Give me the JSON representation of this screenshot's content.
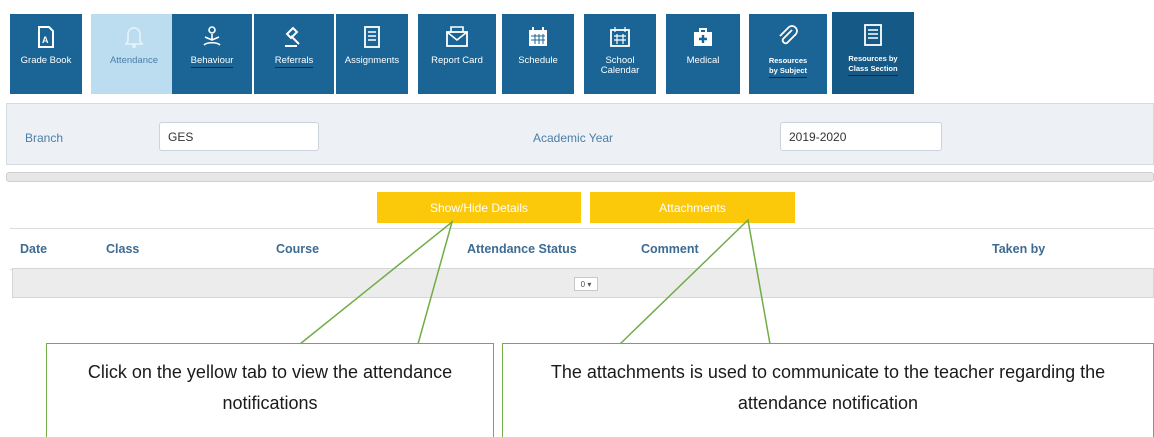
{
  "toolbar": {
    "items": [
      {
        "label": "Grade Book",
        "icon": "grade-book-icon"
      },
      {
        "label": "Attendance",
        "icon": "bell-icon"
      },
      {
        "label": "Behaviour",
        "icon": "person-meditate-icon"
      },
      {
        "label": "Referrals",
        "icon": "gavel-icon"
      },
      {
        "label": "Assignments",
        "icon": "checklist-icon"
      },
      {
        "label": "Report Card",
        "icon": "envelope-icon"
      },
      {
        "label": "Schedule",
        "icon": "calendar-icon"
      },
      {
        "label": "School\nCalendar",
        "icon": "calendar-grid-icon"
      },
      {
        "label": "Medical",
        "icon": "medical-kit-icon"
      },
      {
        "label": "Resources\nby Subject",
        "icon": "paperclip-icon"
      },
      {
        "label": "Resources by\nClass Section",
        "icon": "list-document-icon"
      }
    ],
    "colors": {
      "button": "#1a6496",
      "active": "#bcdcf0"
    }
  },
  "filters": {
    "branch_label": "Branch",
    "branch_value": "GES",
    "year_label": "Academic Year",
    "year_value": "2019-2020"
  },
  "actions": {
    "show_hide": "Show/Hide Details",
    "attachments": "Attachments",
    "color": "#fcc80a"
  },
  "grid": {
    "columns": [
      "Date",
      "Class",
      "Course",
      "Attendance Status",
      "Comment",
      "Taken by"
    ],
    "pager_value": "0 ▾"
  },
  "callouts": {
    "left": "Click on the yellow tab to view the attendance notifications",
    "right": "The attachments is used to communicate to the teacher regarding the attendance notification",
    "border_color": "#70ad47"
  }
}
